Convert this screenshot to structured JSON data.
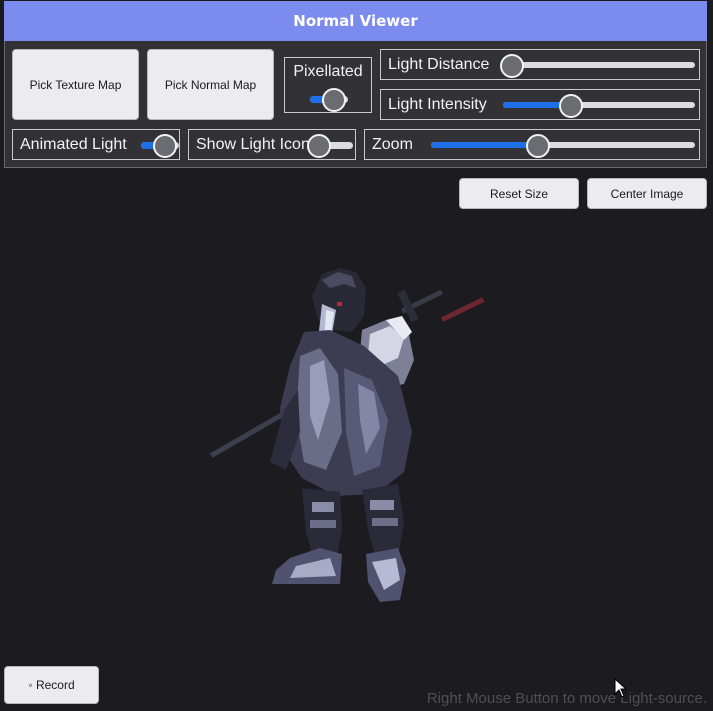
{
  "window": {
    "title": "Normal Viewer"
  },
  "controls": {
    "pick_texture_label": "Pick Texture Map",
    "pick_normal_label": "Pick Normal Map",
    "pixellated": {
      "label": "Pixellated",
      "on": true
    },
    "light_distance": {
      "label": "Light Distance",
      "value": 0.04
    },
    "light_intensity": {
      "label": "Light Intensity",
      "value": 0.35
    },
    "animated_light": {
      "label": "Animated Light",
      "on": true
    },
    "show_light_icon": {
      "label": "Show Light Icon",
      "on": false
    },
    "zoom": {
      "label": "Zoom",
      "value": 0.4
    }
  },
  "view_buttons": {
    "reset_size_label": "Reset Size",
    "center_image_label": "Center Image"
  },
  "record": {
    "label": "◦ Record"
  },
  "status": {
    "hint": "Right Mouse Button to move Light-source."
  },
  "colors": {
    "accent": "#1e6ee8",
    "titlebar": "#7c8cee",
    "background": "#1c1b20"
  }
}
